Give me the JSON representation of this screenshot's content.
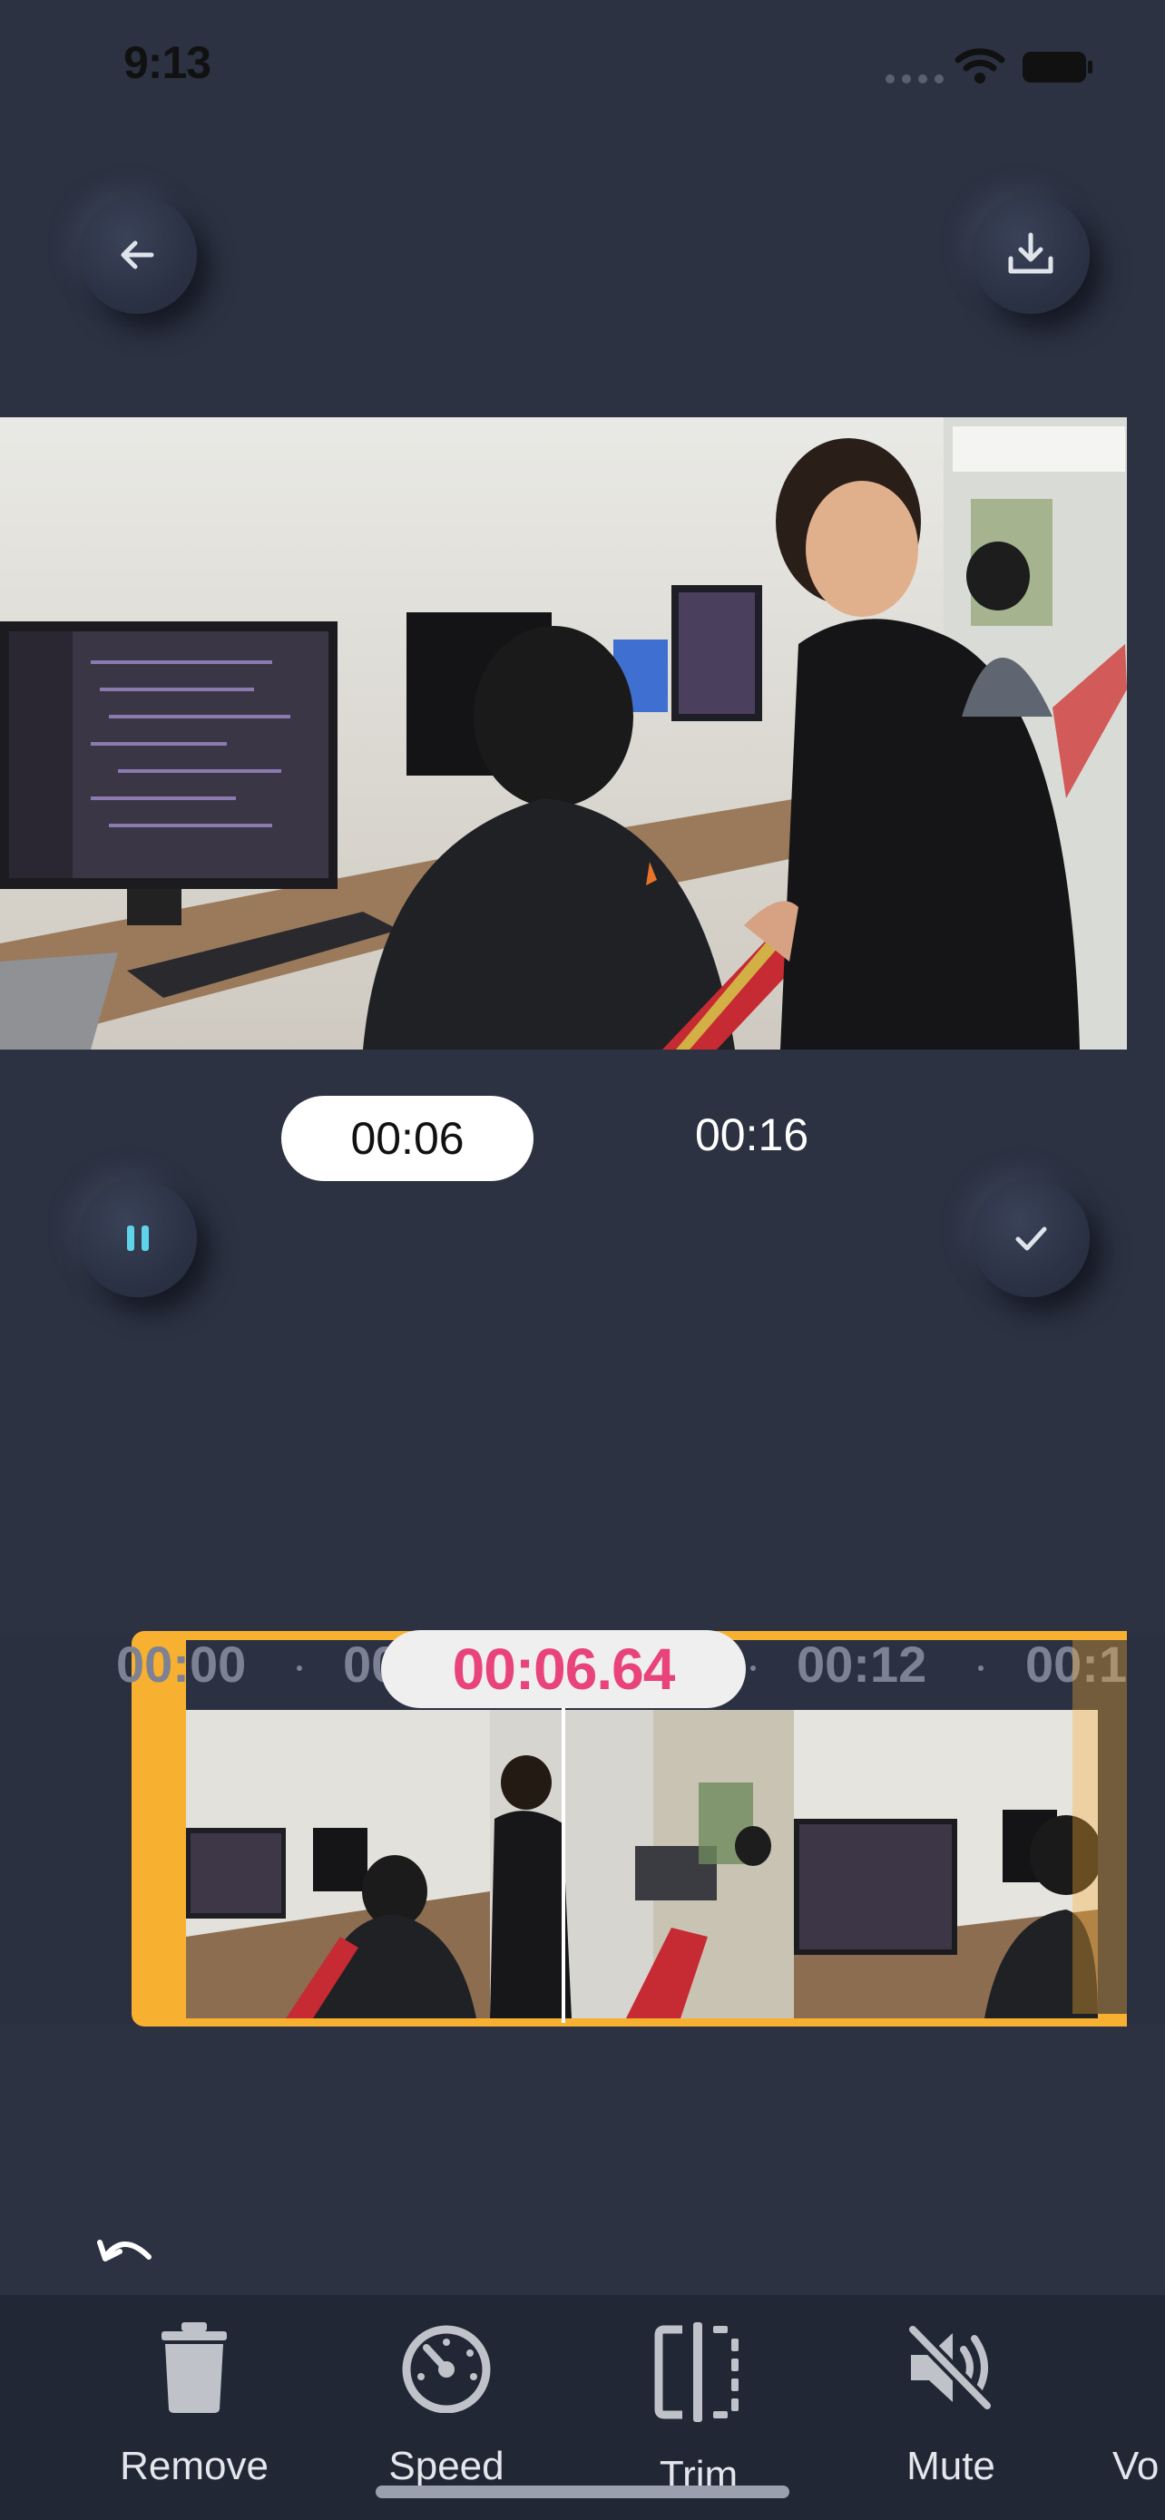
{
  "status_bar": {
    "time": "9:13"
  },
  "header": {
    "back_icon": "arrow-left-icon",
    "download_icon": "download-icon"
  },
  "player": {
    "current_time": "00:06",
    "total_time": "00:16",
    "pause_icon": "pause-icon",
    "confirm_icon": "check-icon"
  },
  "timeline": {
    "ticks": [
      "00:00",
      "00:06",
      "00:12",
      "00:1"
    ],
    "playhead_time": "00:06.64",
    "accent_color": "#f8b031",
    "playhead_color": "#e8437a"
  },
  "undo_icon": "undo-icon",
  "toolbar": {
    "items": [
      {
        "label": "Remove",
        "icon": "trash-icon"
      },
      {
        "label": "Speed",
        "icon": "speedometer-icon"
      },
      {
        "label": "Trim",
        "icon": "trim-icon"
      },
      {
        "label": "Mute",
        "icon": "mute-icon"
      },
      {
        "label": "Vo",
        "icon": "volume-icon"
      }
    ]
  }
}
